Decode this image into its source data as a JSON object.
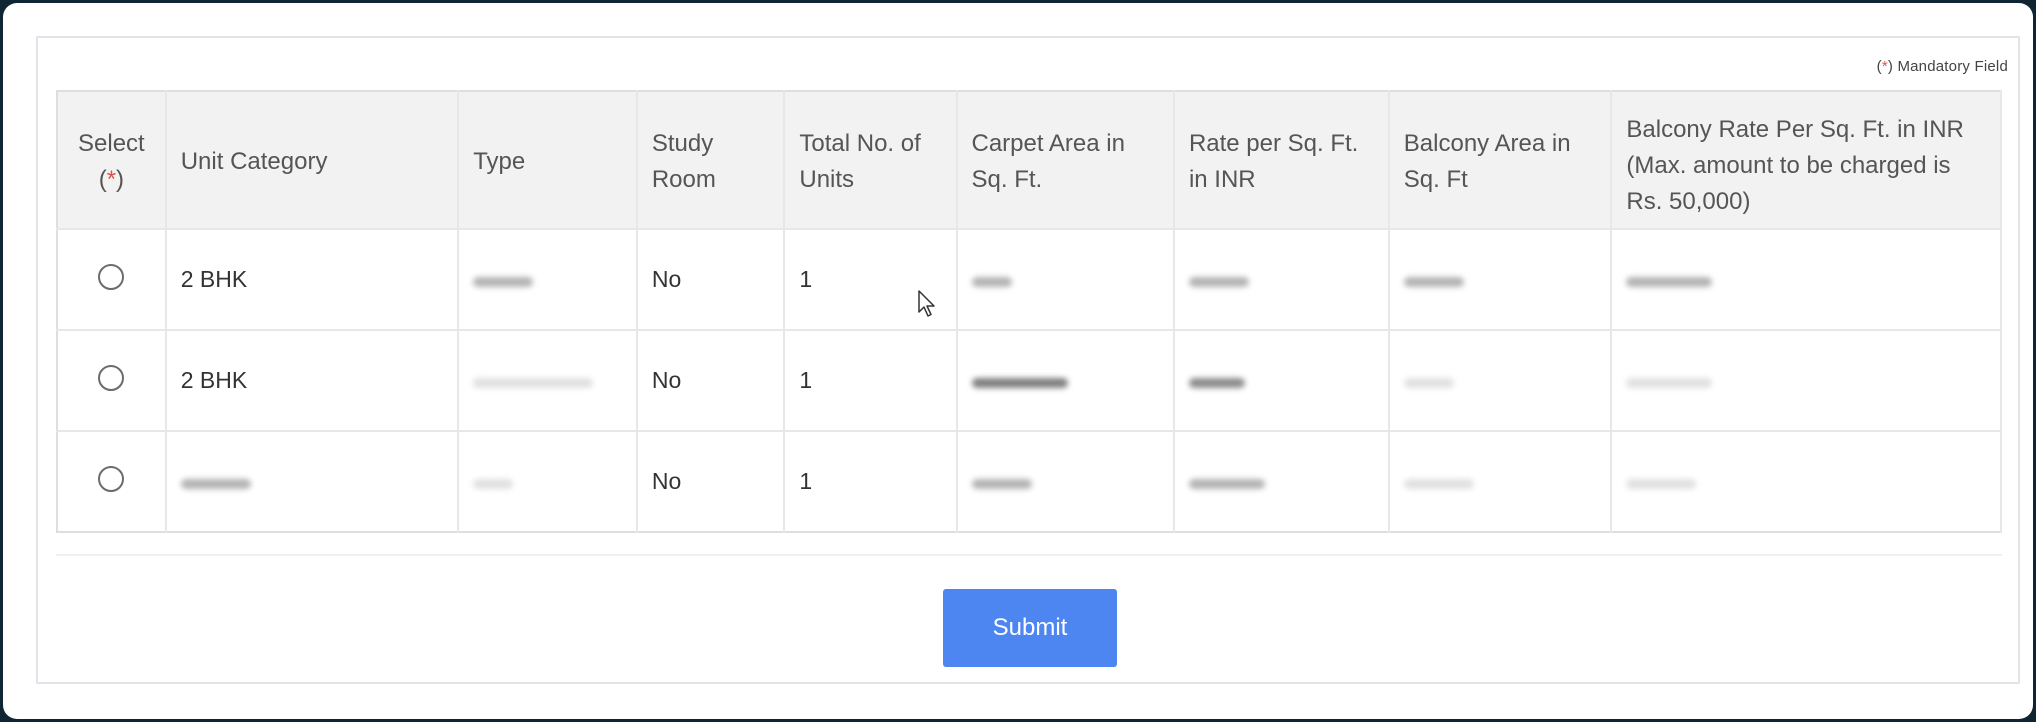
{
  "form": {
    "mandatory_open": "(",
    "mandatory_star": "*",
    "mandatory_close": ")",
    "mandatory_text": "Mandatory Field",
    "submit_label": "Submit"
  },
  "table": {
    "headers": {
      "select": "Select",
      "select_open": "(",
      "select_star": "*",
      "select_close": ")",
      "unit_category": "Unit Category",
      "type": "Type",
      "study_room": "Study Room",
      "total_units": "Total No. of Units",
      "carpet_area": "Carpet Area in Sq. Ft.",
      "rate": "Rate per Sq. Ft. in INR",
      "balcony_area": "Balcony Area in Sq. Ft",
      "balcony_rate": "Balcony Rate Per Sq. Ft. in INR (Max. amount to be charged is Rs. 50,000)"
    },
    "rows": [
      {
        "unit_category": "2 BHK",
        "study_room": "No",
        "total_units": "1"
      },
      {
        "unit_category": "2 BHK",
        "study_room": "No",
        "total_units": "1"
      },
      {
        "unit_category": "",
        "study_room": "No",
        "total_units": "1"
      }
    ]
  },
  "colors": {
    "accent": "#4d86f0",
    "mandatory_star": "#d9534f",
    "header_bg": "#f2f2f2"
  }
}
